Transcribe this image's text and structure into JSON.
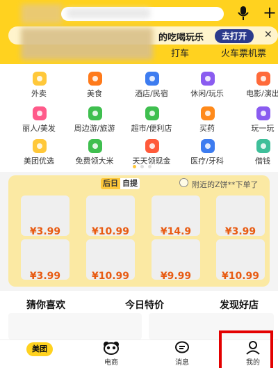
{
  "header": {
    "banner_text": "的吃喝玩乐",
    "banner_button": "去打开",
    "banner_close": "✕",
    "plus": "+",
    "sub_tabs": [
      "打车",
      "火车票机票"
    ]
  },
  "grid": [
    {
      "label": "外卖",
      "icon": "takeout-icon",
      "color": "#ffc83a"
    },
    {
      "label": "美食",
      "icon": "fork-knife-icon",
      "color": "#ff7a1a"
    },
    {
      "label": "酒店/民宿",
      "icon": "hotel-icon",
      "color": "#3d7cf0"
    },
    {
      "label": "休闲/玩乐",
      "icon": "leisure-icon",
      "color": "#8a5cf0"
    },
    {
      "label": "电影/演出",
      "icon": "movie-icon",
      "color": "#ff6a3a"
    },
    {
      "label": "丽人/美发",
      "icon": "beauty-icon",
      "color": "#ff5a8a"
    },
    {
      "label": "周边游/旅游",
      "icon": "palm-tree-icon",
      "color": "#3fbf4f"
    },
    {
      "label": "超市/便利店",
      "icon": "basket-icon",
      "color": "#3fbf4f"
    },
    {
      "label": "买药",
      "icon": "medicine-icon",
      "color": "#ff8a1a"
    },
    {
      "label": "玩一玩",
      "icon": "gamepad-icon",
      "color": "#8a5cf0"
    },
    {
      "label": "美团优选",
      "icon": "youxuan-icon",
      "color": "#ffc83a"
    },
    {
      "label": "免费领大米",
      "icon": "tree-icon",
      "color": "#3fbf4f"
    },
    {
      "label": "天天领现金",
      "icon": "cash-icon",
      "color": "#ff5a3a"
    },
    {
      "label": "医疗/牙科",
      "icon": "medical-cross-icon",
      "color": "#3d7cf0"
    },
    {
      "label": "借钱",
      "icon": "card-icon",
      "color": "#3fbf9a"
    }
  ],
  "deals": {
    "tag_a": "后日",
    "tag_b": "自提",
    "note": "附近的Z饼**下单了",
    "prices": [
      "¥3.99",
      "¥10.99",
      "¥14.9",
      "¥3.99",
      "¥3.99",
      "¥10.99",
      "¥9.99",
      "¥10.99"
    ]
  },
  "tabs": [
    "猜你喜欢",
    "今日特价",
    "发现好店"
  ],
  "nav": [
    {
      "label": "美团",
      "icon": "home-icon"
    },
    {
      "label": "电商",
      "icon": "panda-icon"
    },
    {
      "label": "消息",
      "icon": "message-icon"
    },
    {
      "label": "我的",
      "icon": "profile-icon"
    }
  ]
}
